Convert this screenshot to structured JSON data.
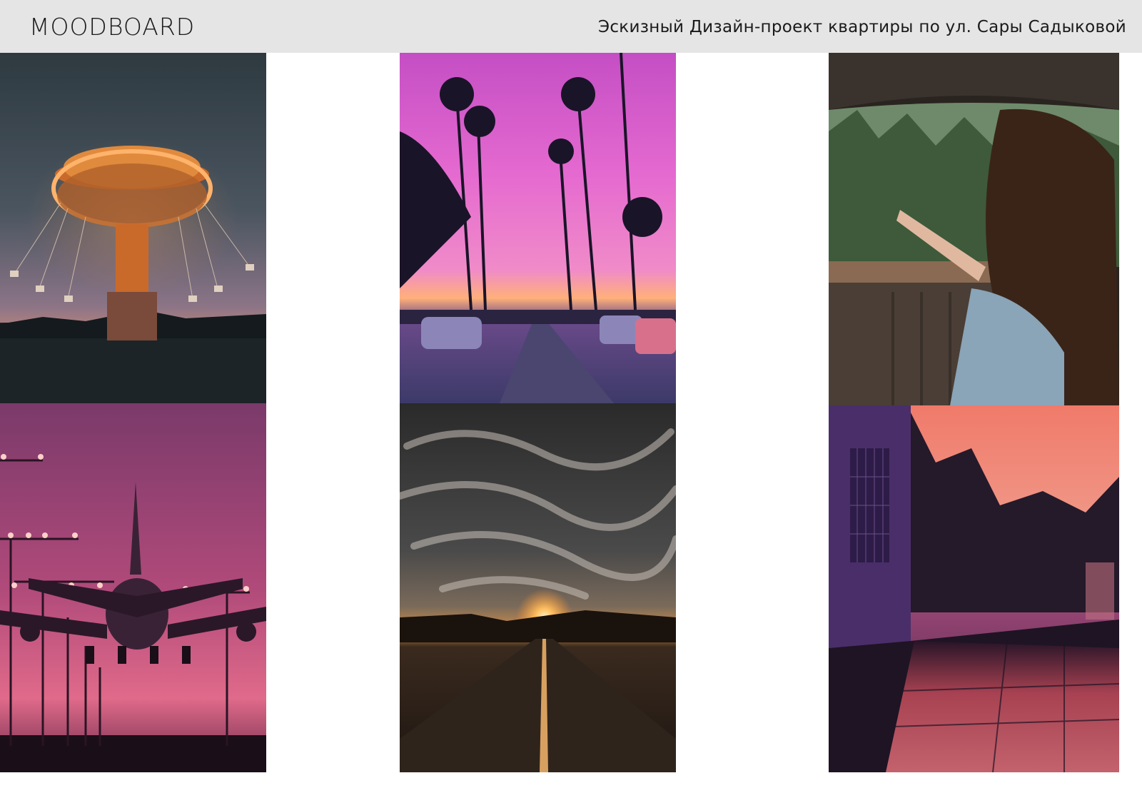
{
  "header": {
    "brand": "MOODBOARD",
    "subtitle": "Эскизный Дизайн-проект квартиры по ул. Сары Садыковой"
  },
  "colors": {
    "header_bg": "#e5e5e5",
    "page_bg": "#ffffff",
    "text": "#1a1a1a"
  },
  "photos": [
    {
      "name": "carousel-ride-at-dusk-photo"
    },
    {
      "name": "palm-tree-street-pink-sky-photo"
    },
    {
      "name": "woman-car-window-photo"
    },
    {
      "name": "airplane-landing-pink-sky-photo"
    },
    {
      "name": "sunset-road-dramatic-clouds-photo"
    },
    {
      "name": "wet-pavement-purple-sunset-photo"
    }
  ]
}
